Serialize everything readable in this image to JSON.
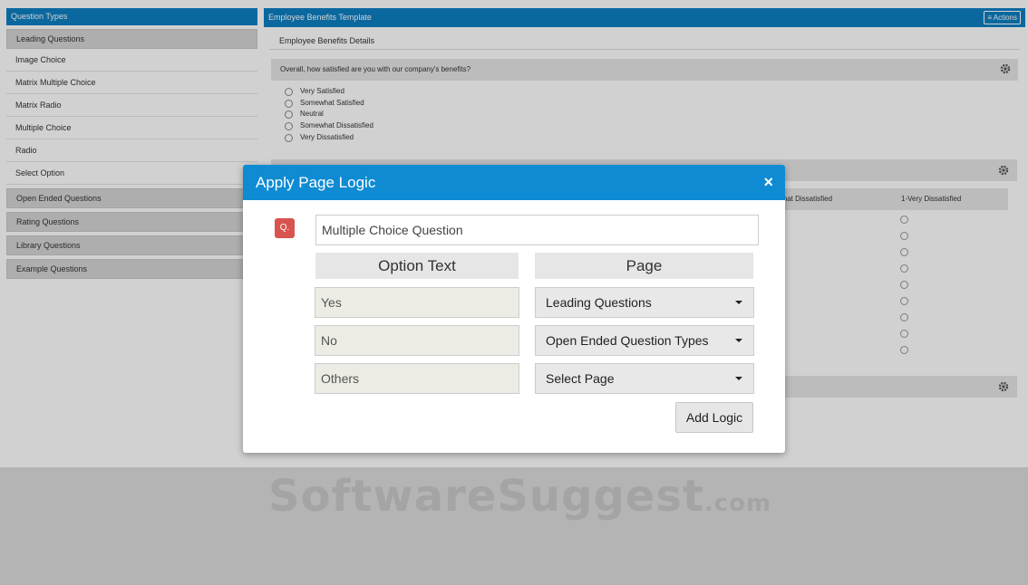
{
  "sidebar": {
    "title": "Question Types",
    "groups": [
      {
        "label": "Leading Questions",
        "items": [
          "Image Choice",
          "Matrix Multiple Choice",
          "Matrix Radio",
          "Multiple Choice",
          "Radio",
          "Select Option"
        ]
      },
      {
        "label": "Open Ended Questions"
      },
      {
        "label": "Rating Questions"
      },
      {
        "label": "Library Questions"
      },
      {
        "label": "Example Questions"
      }
    ]
  },
  "main": {
    "title": "Employee Benefits Template",
    "actions_label": "Actions",
    "subtitle": "Employee Benefits Details",
    "question1": {
      "text": "Overall, how satisfied are you with our company's benefits?",
      "options": [
        "Very Satisfied",
        "Somewhat Satisfied",
        "Neutral",
        "Somewhat Dissatisfied",
        "Very Dissatisfied"
      ]
    },
    "matrix_headers": [
      "what Dissatisfied",
      "1-Very Dissatisfied"
    ]
  },
  "modal": {
    "title": "Apply Page Logic",
    "close_glyph": "×",
    "badge": "Q.",
    "question_value": "Multiple Choice Question",
    "option_header": "Option Text",
    "page_header": "Page",
    "rows": [
      {
        "option": "Yes",
        "page": "Leading Questions"
      },
      {
        "option": "No",
        "page": "Open Ended Question Types"
      },
      {
        "option": "Others",
        "page": "Select Page"
      }
    ],
    "add_button": "Add Logic"
  },
  "watermark": {
    "main": "SoftwareSuggest",
    "suffix": ".com"
  },
  "colors": {
    "header_blue": "#0e7fc2",
    "modal_blue": "#0e8bd3",
    "badge_red": "#d9534f"
  }
}
